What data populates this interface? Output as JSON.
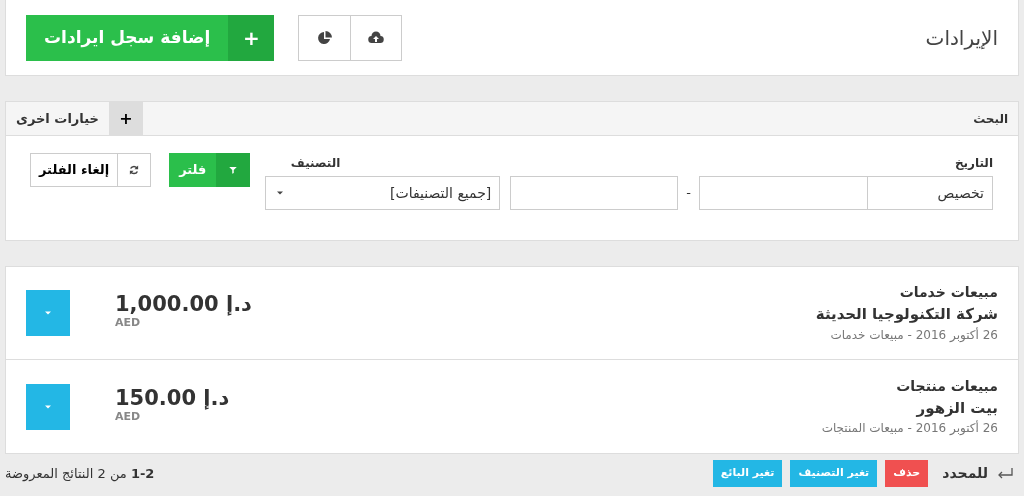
{
  "header": {
    "title": "الإيرادات",
    "add_button": "إضافة سجل ايرادات",
    "add_icon": "+"
  },
  "search": {
    "title": "البحث",
    "more_icon": "+",
    "more_label": "خيارات اخرى",
    "date": {
      "label": "التاريخ",
      "value": "تخصيص",
      "separator": "-"
    },
    "category": {
      "label": "التصنيف",
      "value": "[جميع التصنيفات]"
    },
    "filter_button": "فلتر",
    "reset_button": "إلغاء الفلتر"
  },
  "records": [
    {
      "category": "مبيعات خدمات",
      "client": "شركة التكنولوجيا الحديثة",
      "meta": "26 أكتوبر 2016 - مبيعات خدمات",
      "amount": "1,000.00 د.إ",
      "currency": "AED"
    },
    {
      "category": "مبيعات منتجات",
      "client": "بيت الزهور",
      "meta": "26 أكتوبر 2016 - مبيعات المنتجات",
      "amount": "150.00 د.إ",
      "currency": "AED"
    }
  ],
  "bulk": {
    "label": "للمحدد",
    "actions": [
      {
        "label": "حذف",
        "kind": "danger"
      },
      {
        "label": "تغير التصنيف",
        "kind": "info"
      },
      {
        "label": "تغير البائع",
        "kind": "info"
      }
    ]
  },
  "results": "**1-2** من 2 النتائج المعروضة"
}
